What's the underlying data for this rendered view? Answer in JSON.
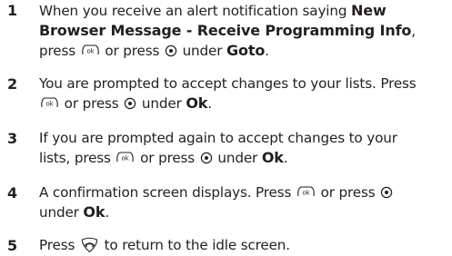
{
  "steps": [
    {
      "number": "1",
      "line1_a": "When you receive an alert notification saying ",
      "line1_b": "New",
      "line2_b": "Browser Message - Receive Programming Info",
      "line2_a": ",",
      "line3_a": "press ",
      "line3_b": " or press ",
      "line3_c": " under ",
      "line3_d": "Goto",
      "line3_e": "."
    },
    {
      "number": "2",
      "line1_a": "You are prompted to accept changes to your lists. Press",
      "line2_a": " or press ",
      "line2_b": " under ",
      "line2_c": "Ok",
      "line2_d": "."
    },
    {
      "number": "3",
      "line1_a": "If you are prompted again to accept changes to your",
      "line2_a": "lists, press ",
      "line2_b": " or press ",
      "line2_c": " under ",
      "line2_d": "Ok",
      "line2_e": "."
    },
    {
      "number": "4",
      "line1_a": "A confirmation screen displays. Press ",
      "line1_b": " or press ",
      "line2_a": "under ",
      "line2_b": "Ok",
      "line2_c": "."
    },
    {
      "number": "5",
      "line1_a": "Press ",
      "line1_b": " to return to the idle screen."
    }
  ],
  "icons": {
    "ok": "ok-key-icon",
    "nav": "navigation-key-icon",
    "end": "end-call-key-icon"
  },
  "colors": {
    "text": "#231f20",
    "number": "#231f20"
  }
}
